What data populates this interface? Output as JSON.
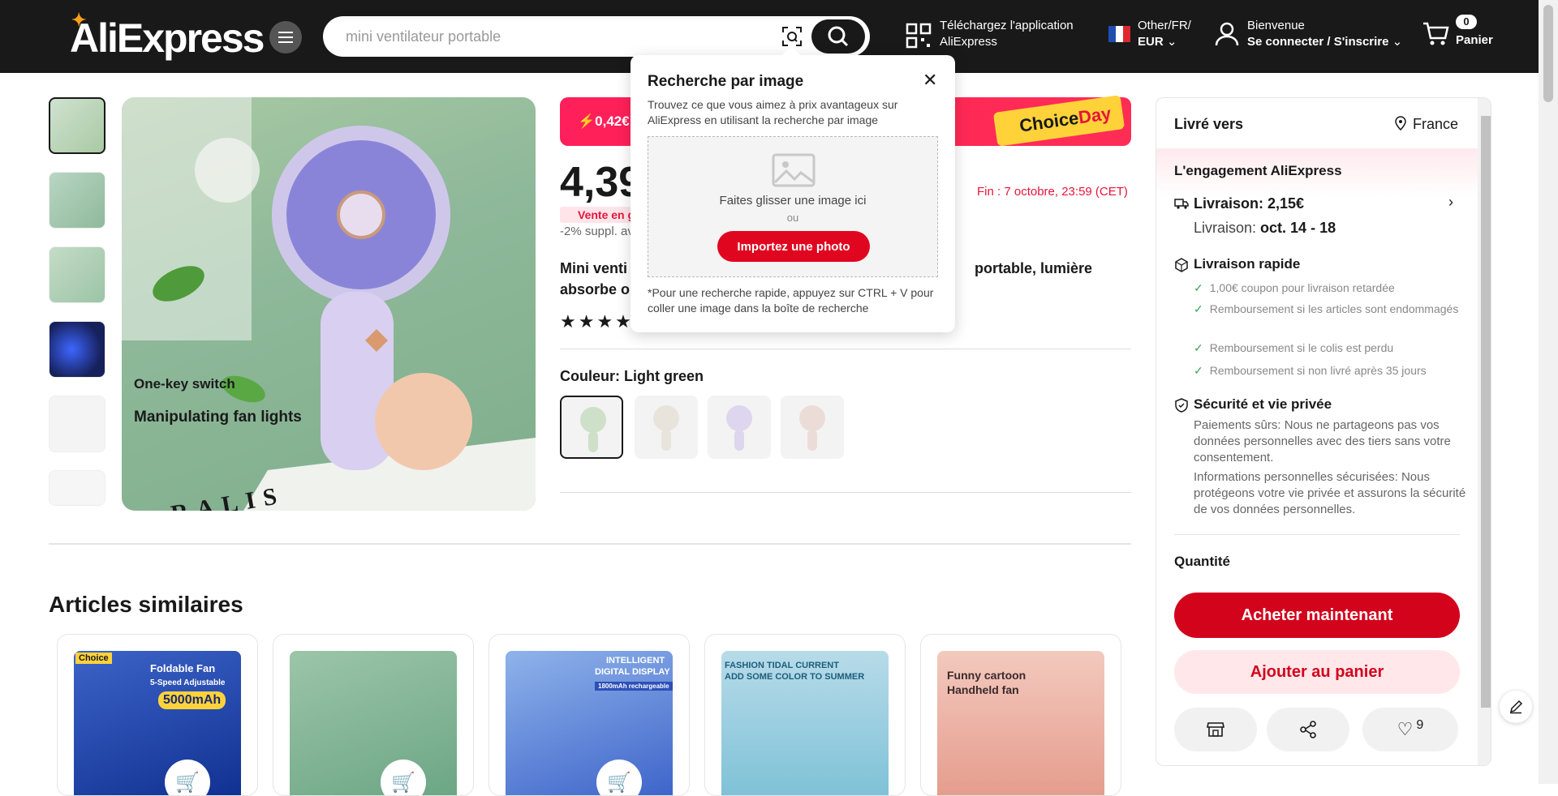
{
  "header": {
    "logo": "AliExpress",
    "search_placeholder": "mini ventilateur portable",
    "app_line1": "Téléchargez l'application",
    "app_line2": "AliExpress",
    "locale_line1": "Other/FR/",
    "locale_line2": "EUR",
    "account_line1": "Bienvenue",
    "account_line2": "Se connecter / S'inscrire",
    "cart_count": "0",
    "cart_label": "Panier"
  },
  "popup": {
    "title": "Recherche par image",
    "desc": "Trouvez ce que vous aimez à prix avantageux sur AliExpress en utilisant la recherche par image",
    "drop_text": "Faites glisser une image ici",
    "or": "ou",
    "import_button": "Importez une photo",
    "note": "*Pour une recherche rapide, appuyez sur CTRL + V pour coller une image dans la boîte de recherche"
  },
  "product": {
    "main_image_caption1": "One-key switch",
    "main_image_caption2": "Manipulating fan lights",
    "banner_amount": "0,42€",
    "choice_tag_1": "Choice",
    "choice_tag_2": "Day",
    "price": "4,39",
    "sale_badge": "Vente en g",
    "surcharge": "-2% suppl. av",
    "end_date": "Fin :  7 octobre, 23:59 (CET)",
    "title_line1_a": "Mini venti",
    "title_line1_b": "portable, lumière",
    "title_line2": "absorbe o",
    "stars": "★★★★★",
    "color_label": "Couleur: Light green",
    "book_text": "RALIS"
  },
  "similar": {
    "title": "Articles similaires",
    "cards": [
      {
        "text1": "Foldable Fan",
        "text2": "5-Speed Adjustable",
        "text3": "5000mAh",
        "badge": "Choice"
      },
      {
        "text1": ""
      },
      {
        "text1": "INTELLIGENT",
        "text2": "DIGITAL DISPLAY",
        "text3": "1800mAh rechargeable"
      },
      {
        "text1": "FASHION TIDAL CURRENT",
        "text2": "ADD SOME COLOR TO SUMMER"
      },
      {
        "text1": "Funny cartoon",
        "text2": "Handheld fan"
      }
    ]
  },
  "panel": {
    "livre_vers": "Livré vers",
    "country": "France",
    "engagement": "L'engagement AliExpress",
    "livraison_price": "Livraison: 2,15€",
    "livraison_dates_label": "Livraison: ",
    "livraison_dates": "oct. 14 - 18",
    "rapide": "Livraison rapide",
    "checks": [
      "1,00€ coupon pour livraison retardée",
      "Remboursement si les articles sont endommagés",
      "Remboursement si le colis est perdu",
      "Remboursement si non livré après 35 jours"
    ],
    "securite": "Sécurité et vie privée",
    "sec_text1": "Paiements sûrs: Nous ne partageons pas vos données personnelles avec des tiers sans votre consentement.",
    "sec_text2": "Informations personnelles sécurisées: Nous protégeons votre vie privée et assurons la sécurité de vos données personnelles.",
    "quantite": "Quantité",
    "buy_now": "Acheter maintenant",
    "add_cart": "Ajouter au panier",
    "wishlist_count": "9"
  },
  "colors": {
    "accent_red": "#d3031c",
    "header_bg": "#191919",
    "banner_pink": "#ff1f5a",
    "choice_yellow": "#ffd23a"
  }
}
